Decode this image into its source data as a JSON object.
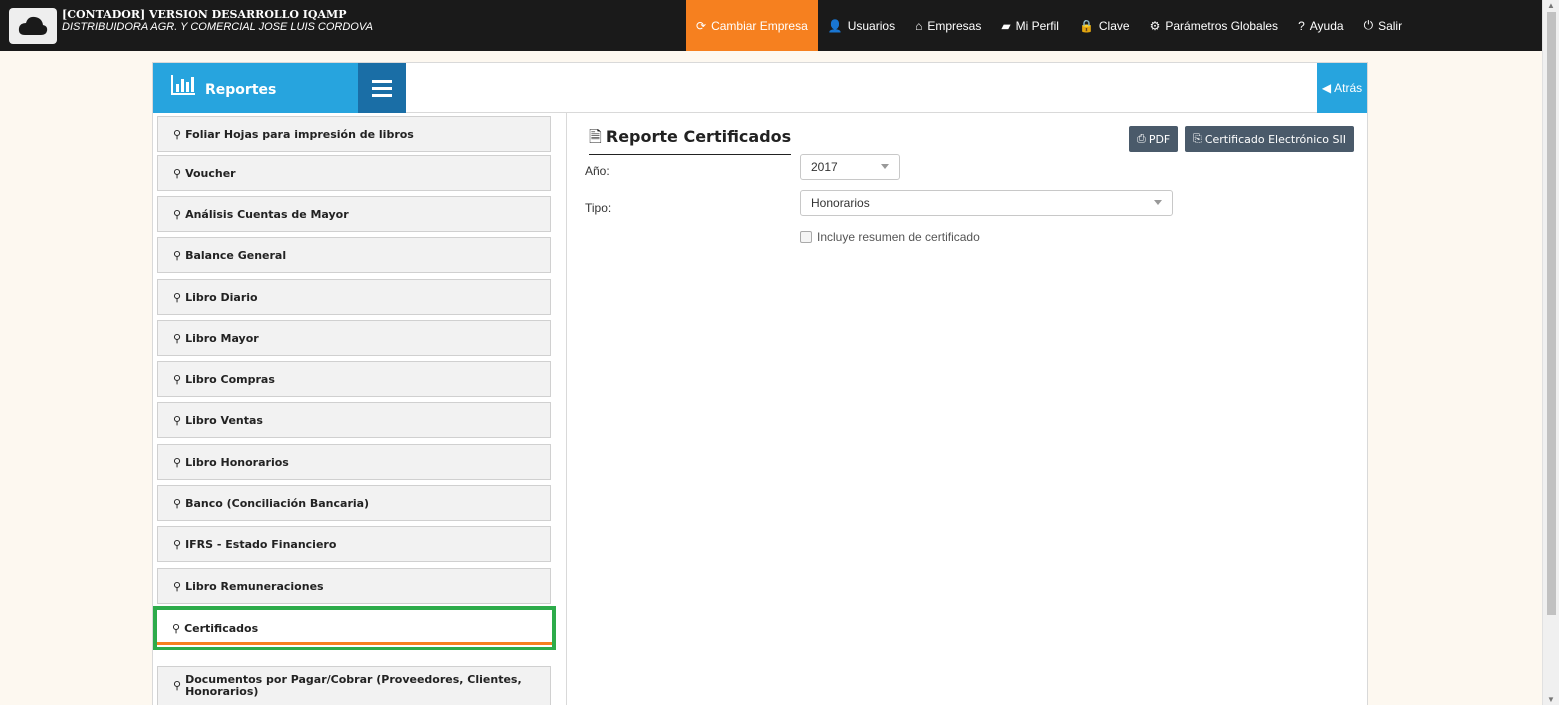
{
  "header": {
    "title": "[CONTADOR] VERSION DESARROLLO IQAMP",
    "subtitle": "DISTRIBUIDORA AGR. Y COMERCIAL JOSE LUIS CORDOVA",
    "logo_icon": "cloud-icon",
    "nav": [
      {
        "label": "Cambiar Empresa",
        "icon": "refresh-icon",
        "glyph": "⟳",
        "active": true
      },
      {
        "label": "Usuarios",
        "icon": "user-icon",
        "glyph": "👤",
        "active": false
      },
      {
        "label": "Empresas",
        "icon": "home-icon",
        "glyph": "⌂",
        "active": false
      },
      {
        "label": "Mi Perfil",
        "icon": "folder-icon",
        "glyph": "▰",
        "active": false
      },
      {
        "label": "Clave",
        "icon": "lock-icon",
        "glyph": "🔒",
        "active": false
      },
      {
        "label": "Parámetros Globales",
        "icon": "gear-icon",
        "glyph": "⚙",
        "active": false
      },
      {
        "label": "Ayuda",
        "icon": "question-icon",
        "glyph": "?",
        "active": false
      },
      {
        "label": "Salir",
        "icon": "power-icon",
        "glyph": "⏻",
        "active": false
      }
    ]
  },
  "panel": {
    "title": "Reportes",
    "back_label": "Atrás"
  },
  "sidebar": {
    "items": [
      {
        "label": "Foliar Hojas para impresión de libros",
        "selected": false
      },
      {
        "label": "Voucher",
        "selected": false
      },
      {
        "label": "Análisis Cuentas de Mayor",
        "selected": false
      },
      {
        "label": "Balance General",
        "selected": false
      },
      {
        "label": "Libro Diario",
        "selected": false
      },
      {
        "label": "Libro Mayor",
        "selected": false
      },
      {
        "label": "Libro Compras",
        "selected": false
      },
      {
        "label": "Libro Ventas",
        "selected": false
      },
      {
        "label": "Libro Honorarios",
        "selected": false
      },
      {
        "label": "Banco (Conciliación Bancaria)",
        "selected": false
      },
      {
        "label": "IFRS - Estado Financiero",
        "selected": false
      },
      {
        "label": "Libro Remuneraciones",
        "selected": false
      },
      {
        "label": "Certificados",
        "selected": true
      },
      {
        "label": "Documentos por Pagar/Cobrar (Proveedores, Clientes, Honorarios)",
        "selected": false
      }
    ]
  },
  "main": {
    "title": "Reporte Certificados",
    "pdf_label": "PDF",
    "cert_label": "Certificado Electrónico SII",
    "year_label": "Año:",
    "year_value": "2017",
    "type_label": "Tipo:",
    "type_value": "Honorarios",
    "checkbox_label": "Incluye resumen de certificado",
    "checkbox_checked": false
  },
  "colors": {
    "topbar": "#1a1a1a",
    "accent_orange": "#f6801f",
    "accent_blue": "#27a4de",
    "selected_border": "#2dab4a"
  }
}
